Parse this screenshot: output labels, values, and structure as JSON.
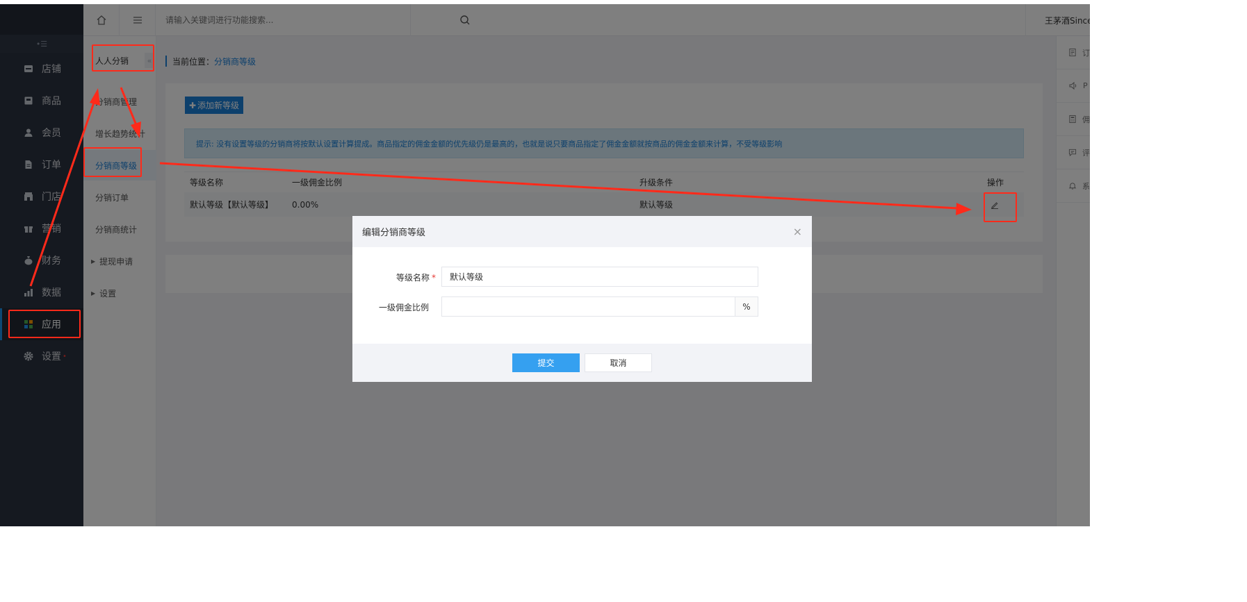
{
  "top_bar": {
    "search_placeholder": "请输入关键词进行功能搜索...",
    "user_name": "王茅酒Since"
  },
  "sidebar": {
    "collapse_glyph": "•☰",
    "items": [
      {
        "label": "店铺",
        "icon": "store-icon"
      },
      {
        "label": "商品",
        "icon": "goods-icon"
      },
      {
        "label": "会员",
        "icon": "member-icon"
      },
      {
        "label": "订单",
        "icon": "order-icon"
      },
      {
        "label": "门店",
        "icon": "shop-icon"
      },
      {
        "label": "营销",
        "icon": "gift-icon"
      },
      {
        "label": "财务",
        "icon": "money-bag-icon"
      },
      {
        "label": "数据",
        "icon": "chart-icon"
      },
      {
        "label": "应用",
        "icon": "apps-icon",
        "active": true
      },
      {
        "label": "设置",
        "icon": "gear-icon",
        "badge": "•"
      }
    ]
  },
  "submenu": {
    "title": "人人分销",
    "toggle": "«",
    "items": [
      {
        "label": "分销商管理"
      },
      {
        "label": "增长趋势统计"
      },
      {
        "label": "分销商等级",
        "active": true
      },
      {
        "label": "分销订单"
      },
      {
        "label": "分销商统计"
      },
      {
        "label": "提现申请",
        "collapsible": true
      },
      {
        "label": "设置",
        "collapsible": true
      }
    ]
  },
  "right_rail": {
    "items": [
      {
        "icon": "document-icon",
        "label": "订"
      },
      {
        "icon": "speaker-icon",
        "label": "P"
      },
      {
        "icon": "calculator-icon",
        "label": "佣"
      },
      {
        "icon": "message-icon",
        "label": "评"
      },
      {
        "icon": "bell-icon",
        "label": "系"
      }
    ]
  },
  "breadcrumb": {
    "prefix": "当前位置：",
    "current": "分销商等级"
  },
  "main": {
    "add_button": "添加新等级",
    "tip": "提示: 没有设置等级的分销商将按默认设置计算提成。商品指定的佣金金额的优先级仍是最高的，也就是说只要商品指定了佣金金额就按商品的佣金金额来计算，不受等级影响",
    "table": {
      "columns": [
        "等级名称",
        "一级佣金比例",
        "升级条件",
        "操作"
      ],
      "rows": [
        {
          "name": "默认等级【默认等级】",
          "rate": "0.00%",
          "condition": "默认等级",
          "action_icon": "edit-icon"
        }
      ]
    }
  },
  "modal": {
    "title": "编辑分销商等级",
    "close": "×",
    "fields": [
      {
        "label": "等级名称",
        "required": true,
        "value": "默认等级",
        "placeholder": ""
      },
      {
        "label": "一级佣金比例",
        "required": false,
        "value": "",
        "placeholder": "",
        "addon": "%"
      }
    ],
    "submit_label": "提交",
    "cancel_label": "取消"
  },
  "annotation_color": "#ff2a1a"
}
